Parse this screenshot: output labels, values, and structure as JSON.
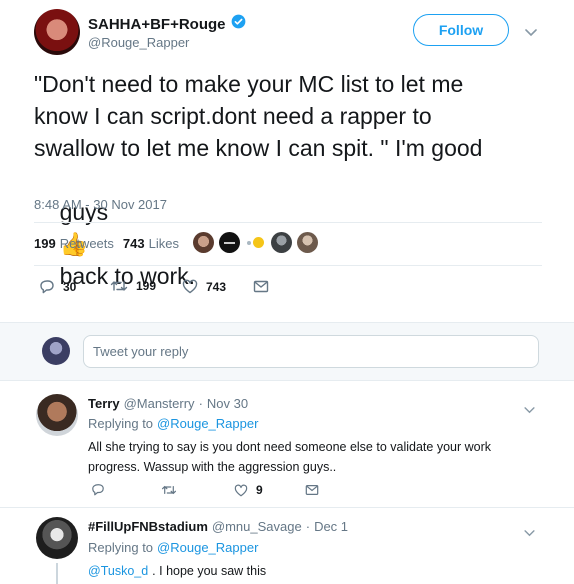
{
  "tweet": {
    "author": {
      "display_name": "SAHHA+BF+Rouge",
      "handle": "@Rouge_Rapper",
      "verified": true
    },
    "follow_label": "Follow",
    "text_line1": "\"Don't need to make your MC list to let me",
    "text_line2": "know I can script.dont need a rapper to",
    "text_line3": "swallow to let me know I can spit. \" I'm good",
    "text_line4_a": "guys",
    "text_line4_emoji": "👍",
    "text_line4_b": "back to work.",
    "timestamp": "8:48 AM - 30 Nov 2017",
    "stats": {
      "retweets_count": "199",
      "retweets_label": "Retweets",
      "likes_count": "743",
      "likes_label": "Likes"
    },
    "actions": {
      "reply_count": "30",
      "retweet_count": "199",
      "like_count": "743"
    }
  },
  "reply_box": {
    "placeholder": "Tweet your reply"
  },
  "replies": [
    {
      "display_name": "Terry",
      "handle": "@Mansterry",
      "separator": "·",
      "time": "Nov 30",
      "replying_prefix": "Replying to",
      "replying_to": "@Rouge_Rapper",
      "text_line1": "All she trying to say is you dont need someone else to validate your work",
      "text_line2": "progress. Wassup with the aggression guys..",
      "like_count": "9"
    },
    {
      "display_name": "#FillUpFNBstadium",
      "handle": "@mnu_Savage",
      "separator": "·",
      "time": "Dec 1",
      "replying_prefix": "Replying to",
      "replying_to": "@Rouge_Rapper",
      "mention": "@Tusko_d",
      "text_rest": ". I hope you saw this"
    }
  ],
  "colors": {
    "accent": "#1da1f2",
    "link": "#1b95e0",
    "muted": "#657786",
    "border": "#e6ecf0",
    "reply_area_bg": "#f5f8fa"
  }
}
